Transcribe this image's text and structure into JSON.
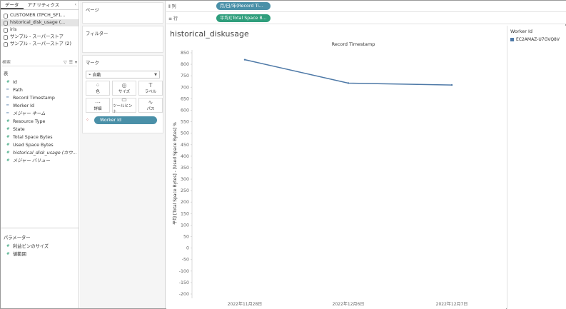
{
  "left_pane": {
    "tabs": [
      "データ",
      "アナリティクス"
    ],
    "collapse": "‹",
    "datasources": [
      {
        "label": "CUSTOMER (TPCH_SF1...",
        "selected": false
      },
      {
        "label": "historical_disk_usage (...",
        "selected": true
      },
      {
        "label": "iris",
        "selected": false
      },
      {
        "label": "サンプル - スーパーストア",
        "selected": false
      },
      {
        "label": "サンプル - スーパーストア (2)",
        "selected": false
      }
    ],
    "search_placeholder": "検索",
    "tables_label": "表",
    "fields": [
      {
        "icon": "#",
        "label": "Id",
        "kind": "mea",
        "italic": false
      },
      {
        "icon": "Abc",
        "label": "Path",
        "kind": "dim",
        "italic": false
      },
      {
        "icon": "Abc",
        "label": "Record Timestamp",
        "kind": "dim",
        "italic": false
      },
      {
        "icon": "Abc",
        "label": "Worker Id",
        "kind": "dim",
        "italic": false
      },
      {
        "icon": "Abc",
        "label": "メジャー ネーム",
        "kind": "dim",
        "italic": true
      },
      {
        "icon": "#",
        "label": "Resource Type",
        "kind": "mea",
        "italic": false
      },
      {
        "icon": "#",
        "label": "State",
        "kind": "mea",
        "italic": false
      },
      {
        "icon": "#",
        "label": "Total Space Bytes",
        "kind": "mea",
        "italic": false
      },
      {
        "icon": "#",
        "label": "Used Space Bytes",
        "kind": "mea",
        "italic": false
      },
      {
        "icon": "#",
        "label": "historical_disk_usage (カウ...",
        "kind": "mea",
        "italic": true
      },
      {
        "icon": "#",
        "label": "メジャー バリュー",
        "kind": "mea",
        "italic": true
      }
    ],
    "params_label": "パラメーター",
    "params": [
      {
        "icon": "#",
        "label": "利益ビンのサイズ"
      },
      {
        "icon": "#",
        "label": "値範囲"
      }
    ]
  },
  "cards": {
    "pages": "ページ",
    "filters": "フィルター",
    "marks": "マーク",
    "mark_type": "自動",
    "mark_buttons": [
      {
        "icon": "⁘",
        "label": "色"
      },
      {
        "icon": "◎",
        "label": "サイズ"
      },
      {
        "icon": "T",
        "label": "ラベル"
      },
      {
        "icon": "⋯",
        "label": "詳細"
      },
      {
        "icon": "▭",
        "label": "ツールヒント"
      },
      {
        "icon": "∿",
        "label": "パス"
      }
    ],
    "detail_pill": "Worker Id"
  },
  "shelves": {
    "columns_label": "列",
    "columns_pill": "月/日/年(Record Ti...",
    "rows_label": "行",
    "rows_pill": "平均([Total Space B..."
  },
  "sheet_title": "historical_diskusage",
  "legend": {
    "title": "Worker Id",
    "items": [
      {
        "label": "EC2AMAZ-U7GVQ8V",
        "color": "#4e79a7"
      }
    ]
  },
  "chart_data": {
    "type": "line",
    "title": "Record Timestamp",
    "xlabel": "",
    "ylabel": "平均 [Total Space Bytes] - [Used Space Bytes] %",
    "x": [
      "2022年11月28日",
      "2022年12月6日",
      "2022年12月7日"
    ],
    "series": [
      {
        "name": "EC2AMAZ-U7GVQ8V",
        "values": [
          820,
          718,
          710
        ],
        "color": "#4e79a7"
      }
    ],
    "ylim": [
      -200,
      850
    ],
    "yticks": [
      850,
      800,
      750,
      700,
      650,
      600,
      550,
      500,
      450,
      400,
      350,
      300,
      250,
      200,
      150,
      100,
      50,
      0,
      -50,
      -100,
      -150,
      -200
    ],
    "ytick_labels": [
      "850",
      "800",
      "750",
      "700",
      "650",
      "600",
      "550",
      "500",
      "450",
      "400",
      "350",
      "300",
      "250",
      "200",
      "150",
      "100",
      "50",
      "0",
      "-50",
      "-100",
      "-150",
      "-200"
    ],
    "grid": false
  }
}
